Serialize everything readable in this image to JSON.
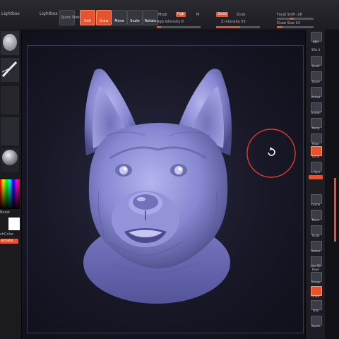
{
  "app": "ZBrush",
  "topbar": {
    "lightbox": "Lightbox",
    "quick_sketch": "Quick\nSketch",
    "edit": "Edit",
    "draw": "Draw",
    "move": "Move",
    "scale": "Scale",
    "rotate": "Rotate",
    "mrgb": "Mrgb",
    "rgb": "Rgb",
    "m": "M",
    "rgb_intensity": "Rgb Intensity 8",
    "zadd": "Zadd",
    "zsub": "Zsub",
    "z_intensity": "Z Intensity 55",
    "focal_shift": "Focal Shift -28",
    "draw_size": "Draw Size 24"
  },
  "left_panel": {
    "boost": "Boost",
    "switch_color": "chColor",
    "alternate": "ernate"
  },
  "right_shelf": {
    "items": [
      "BPR",
      "SPix 3",
      "Scroll",
      "Zoom",
      "Actual",
      "AAHalf",
      "Persp",
      "Floor",
      "Local",
      "L.Sym",
      "Frame",
      "Move",
      "Scale",
      "Rotate",
      "Line Fill\nPolyF",
      "Transp",
      "Ghost",
      "Solo",
      "Xpose"
    ]
  },
  "viewport": {
    "model": "german-shepherd-head-sculpt",
    "cursor": "rotate-cursor"
  },
  "colors": {
    "accent": "#e8522e",
    "model": "#8f8fd8"
  }
}
